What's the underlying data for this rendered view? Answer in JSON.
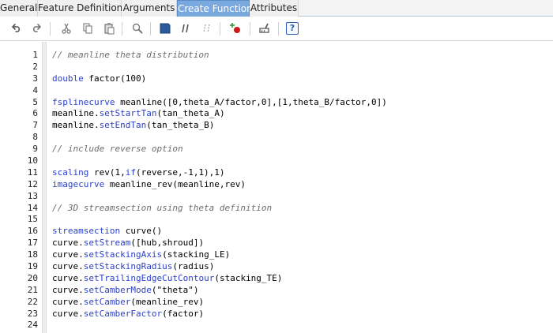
{
  "tabs": [
    {
      "label": "General",
      "active": false
    },
    {
      "label": "Feature Definitions",
      "active": false
    },
    {
      "label": "Arguments",
      "active": false
    },
    {
      "label": "Create Function",
      "active": true
    },
    {
      "label": "Attributes",
      "active": false
    }
  ],
  "toolbar": {
    "icons": [
      "undo-icon",
      "redo-icon",
      "cut-icon",
      "copy-icon",
      "paste-icon",
      "find-icon",
      "bookmark-icon",
      "comment-icon",
      "uncomment-icon",
      "insert-feature-icon",
      "clear-icon",
      "help-icon"
    ],
    "help_label": "?"
  },
  "colors": {
    "keyword": "#2a3fcc",
    "comment": "#6d6d6d",
    "active_tab": "#7aa9e0"
  },
  "editor": {
    "lines": [
      {
        "num": "1",
        "text": "// meanline theta distribution"
      },
      {
        "num": "2",
        "text": ""
      },
      {
        "num": "3",
        "text": "double factor(100)"
      },
      {
        "num": "4",
        "text": ""
      },
      {
        "num": "5",
        "text": "fsplinecurve meanline([0,theta_A/factor,0],[1,theta_B/factor,0])"
      },
      {
        "num": "6",
        "text": "meanline.setStartTan(tan_theta_A)"
      },
      {
        "num": "7",
        "text": "meanline.setEndTan(tan_theta_B)"
      },
      {
        "num": "8",
        "text": ""
      },
      {
        "num": "9",
        "text": "// include reverse option"
      },
      {
        "num": "10",
        "text": ""
      },
      {
        "num": "11",
        "text": "scaling rev(1,if(reverse,-1,1),1)"
      },
      {
        "num": "12",
        "text": "imagecurve meanline_rev(meanline,rev)"
      },
      {
        "num": "13",
        "text": ""
      },
      {
        "num": "14",
        "text": "// 3D streamsection using theta definition"
      },
      {
        "num": "15",
        "text": ""
      },
      {
        "num": "16",
        "text": "streamsection curve()"
      },
      {
        "num": "17",
        "text": "curve.setStream([hub,shroud])"
      },
      {
        "num": "18",
        "text": "curve.setStackingAxis(stacking_LE)"
      },
      {
        "num": "19",
        "text": "curve.setStackingRadius(radius)"
      },
      {
        "num": "20",
        "text": "curve.setTrailingEdgeCutContour(stacking_TE)"
      },
      {
        "num": "21",
        "text": "curve.setCamberMode(\"theta\")"
      },
      {
        "num": "22",
        "text": "curve.setCamber(meanline_rev)"
      },
      {
        "num": "23",
        "text": "curve.setCamberFactor(factor)"
      },
      {
        "num": "24",
        "text": ""
      }
    ]
  }
}
